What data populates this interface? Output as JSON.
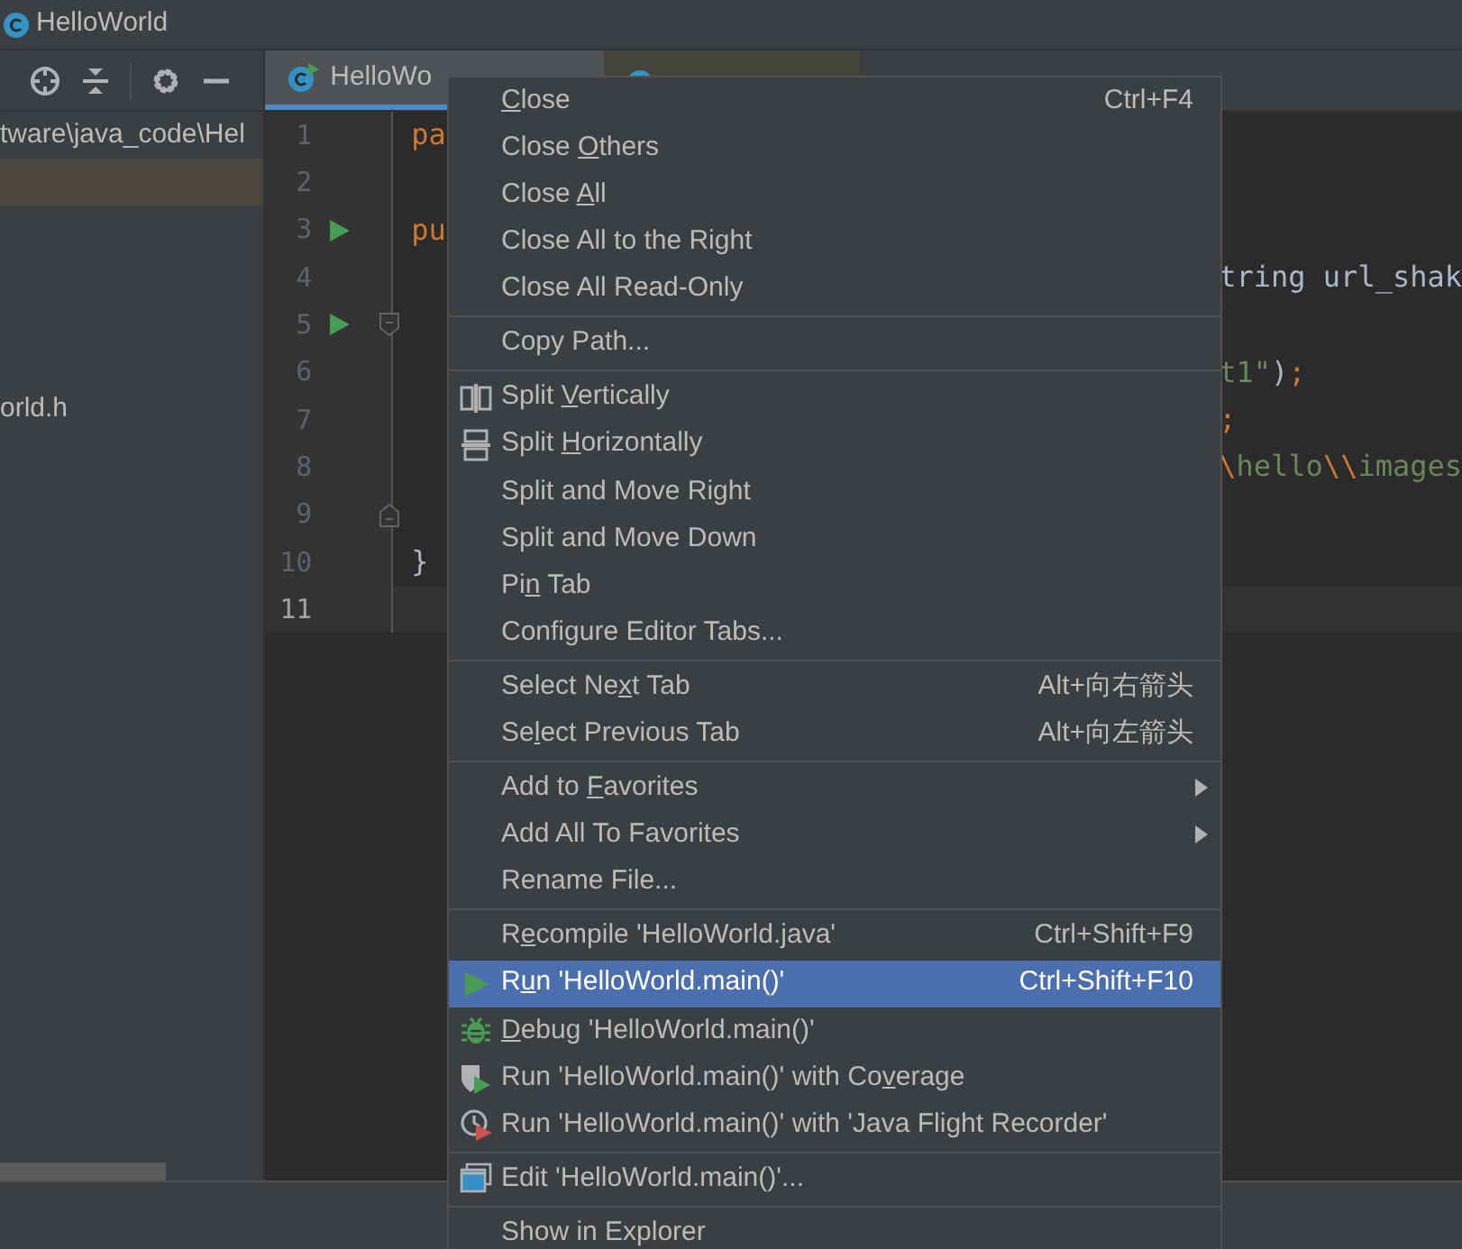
{
  "window": {
    "title": "HelloWorld"
  },
  "project_panel": {
    "toolbar": [
      {
        "kind": "locate"
      },
      {
        "kind": "collapse"
      },
      {
        "kind": "divider"
      },
      {
        "kind": "settings"
      },
      {
        "kind": "hide"
      }
    ],
    "rows": [
      {
        "text": "tware\\java_code\\Hel",
        "selected": false
      },
      {
        "selected": true
      },
      {
        "text": "orld.h",
        "selected": false
      }
    ]
  },
  "editor": {
    "tabs": [
      {
        "label": "HelloWo",
        "selected": true
      },
      {
        "selected": false
      }
    ],
    "lines": [
      {
        "number": "1",
        "left": [
          {
            "text": "pa",
            "kind": "keyword"
          }
        ],
        "run": false,
        "current": false
      },
      {
        "number": "2",
        "run": false,
        "current": false
      },
      {
        "number": "3",
        "left": [
          {
            "text": "pu",
            "kind": "keyword"
          }
        ],
        "run": true,
        "current": false
      },
      {
        "number": "4",
        "right": [
          {
            "text": "tring url_shak",
            "kind": "plain"
          }
        ],
        "run": false,
        "current": false
      },
      {
        "number": "5",
        "run": true,
        "fold_open": true,
        "current": false
      },
      {
        "number": "6",
        "right": [
          {
            "text": "t1\"",
            "kind": "string"
          },
          {
            "text": ")",
            "kind": "plain"
          },
          {
            "text": ";",
            "kind": "keyword"
          }
        ],
        "run": false,
        "current": false
      },
      {
        "number": "7",
        "right": [
          {
            "text": ";",
            "kind": "keyword"
          }
        ],
        "run": false,
        "current": false
      },
      {
        "number": "8",
        "right": [
          {
            "text": "\\",
            "kind": "keyword"
          },
          {
            "text": "hello",
            "kind": "string"
          },
          {
            "text": "\\\\",
            "kind": "keyword"
          },
          {
            "text": "images",
            "kind": "string"
          }
        ],
        "run": false,
        "current": false
      },
      {
        "number": "9",
        "run": false,
        "fold_close": true,
        "current": false
      },
      {
        "number": "10",
        "left": [
          {
            "text": "}",
            "kind": "plain"
          }
        ],
        "run": false,
        "current": false
      },
      {
        "number": "11",
        "run": false,
        "current": true
      }
    ]
  },
  "context_menu": {
    "items": [
      {
        "kind": "plain",
        "key": "C",
        "post": "lose",
        "shortcut": "Ctrl+F4",
        "selected": false
      },
      {
        "kind": "plain",
        "pre": "Close ",
        "key": "O",
        "post": "thers",
        "selected": false
      },
      {
        "kind": "plain",
        "pre": "Close ",
        "key": "A",
        "post": "ll",
        "selected": false
      },
      {
        "kind": "plain",
        "pre": "Close All to the Right",
        "selected": false
      },
      {
        "kind": "plain",
        "pre": "Close All Read-Only",
        "selected": false
      },
      {
        "kind": "separator"
      },
      {
        "kind": "plain",
        "pre": "Copy Path...",
        "selected": false
      },
      {
        "kind": "separator"
      },
      {
        "kind": "split_vertical",
        "pre": "Split ",
        "key": "V",
        "post": "ertically",
        "selected": false
      },
      {
        "kind": "split_horizontal",
        "pre": "Split ",
        "key": "H",
        "post": "orizontally",
        "selected": false
      },
      {
        "kind": "plain",
        "pre": "Split and Move Right",
        "selected": false
      },
      {
        "kind": "plain",
        "pre": "Split and Move Down",
        "selected": false
      },
      {
        "kind": "plain",
        "pre": "Pi",
        "key": "n",
        "post": " Tab",
        "selected": false
      },
      {
        "kind": "plain",
        "pre": "Configure Editor Tabs...",
        "selected": false
      },
      {
        "kind": "separator"
      },
      {
        "kind": "plain",
        "pre": "Select Ne",
        "key": "x",
        "post": "t Tab",
        "shortcut": "Alt+向右箭头",
        "selected": false
      },
      {
        "kind": "plain",
        "pre": "Se",
        "key": "l",
        "post": "ect Previous Tab",
        "shortcut": "Alt+向左箭头",
        "selected": false
      },
      {
        "kind": "separator"
      },
      {
        "kind": "plain",
        "pre": "Add to ",
        "key": "F",
        "post": "avorites",
        "submenu": true,
        "selected": false
      },
      {
        "kind": "plain",
        "pre": "Add All To Favorites",
        "submenu": true,
        "selected": false
      },
      {
        "kind": "plain",
        "pre": "Rename File...",
        "selected": false
      },
      {
        "kind": "separator"
      },
      {
        "kind": "plain",
        "pre": "R",
        "key": "e",
        "post": "compile 'HelloWorld.java'",
        "shortcut": "Ctrl+Shift+F9",
        "selected": false
      },
      {
        "kind": "run",
        "pre": "R",
        "key": "u",
        "post": "n 'HelloWorld.main()'",
        "shortcut": "Ctrl+Shift+F10",
        "selected": true
      },
      {
        "kind": "debug",
        "key": "D",
        "post": "ebug 'HelloWorld.main()'",
        "selected": false
      },
      {
        "kind": "coverage",
        "pre": "Run 'HelloWorld.main()' with Co",
        "key": "v",
        "post": "erage",
        "selected": false
      },
      {
        "kind": "profiler",
        "pre": "Run 'HelloWorld.main()' with 'Java Flight Recorder'",
        "selected": false
      },
      {
        "kind": "separator"
      },
      {
        "kind": "edit_config",
        "pre": "Edit 'HelloWorld.main()'...",
        "selected": false
      },
      {
        "kind": "separator"
      },
      {
        "kind": "plain",
        "pre": "Show in Explorer",
        "selected": false
      }
    ]
  }
}
